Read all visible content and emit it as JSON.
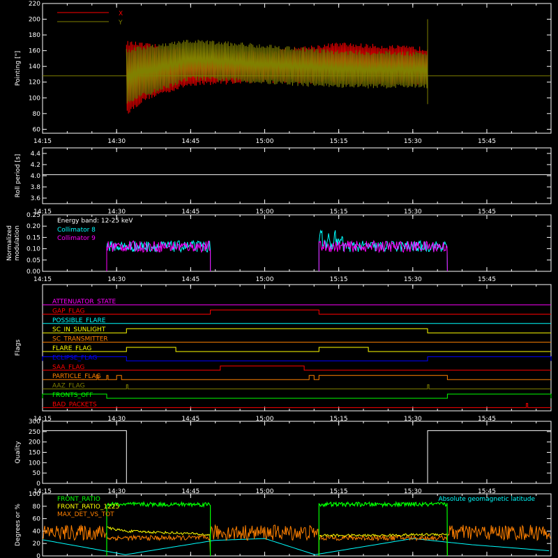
{
  "time_ticks": [
    "14:15",
    "14:30",
    "14:45",
    "15:00",
    "15:15",
    "15:30",
    "15:45"
  ],
  "chart_data": [
    {
      "type": "line",
      "ylabel": "Pointing [\"]",
      "ylim": [
        55,
        220
      ],
      "yticks": [
        60,
        80,
        100,
        120,
        140,
        160,
        180,
        200,
        220
      ],
      "legend": [
        {
          "name": "X",
          "color": "#ff0000"
        },
        {
          "name": "Y",
          "color": "#808000"
        }
      ],
      "series": [
        {
          "name": "X",
          "color": "#ff0000",
          "t_start": "14:32",
          "t_end": "15:33",
          "upper": [
            [
              14.53,
              170
            ],
            [
              14.75,
              160
            ],
            [
              15.0,
              158
            ],
            [
              15.25,
              168
            ],
            [
              15.55,
              162
            ]
          ],
          "lower": [
            [
              14.53,
              80
            ],
            [
              14.6,
              100
            ],
            [
              14.75,
              118
            ],
            [
              15.0,
              122
            ],
            [
              15.25,
              120
            ],
            [
              15.55,
              118
            ]
          ]
        },
        {
          "name": "Y",
          "color": "#808000",
          "t_start": "14:32",
          "t_end": "15:33",
          "upper": [
            [
              14.53,
              160
            ],
            [
              14.75,
              172
            ],
            [
              15.0,
              166
            ],
            [
              15.25,
              158
            ],
            [
              15.55,
              156
            ]
          ],
          "lower": [
            [
              14.53,
              95
            ],
            [
              14.75,
              125
            ],
            [
              15.0,
              120
            ],
            [
              15.25,
              115
            ],
            [
              15.55,
              115
            ]
          ]
        }
      ],
      "reference_y": 128
    },
    {
      "type": "line",
      "ylabel": "Roll period [s]",
      "ylim": [
        3.5,
        4.5
      ],
      "yticks": [
        3.6,
        3.8,
        4.0,
        4.2,
        4.4
      ],
      "series": [
        {
          "name": "",
          "color": "#ffffff",
          "constant": 4.02
        }
      ]
    },
    {
      "type": "line",
      "ylabel": "Normalized modulation",
      "ylim": [
        0,
        0.25
      ],
      "yticks": [
        0.0,
        0.05,
        0.1,
        0.15,
        0.2,
        0.25
      ],
      "annotation": "Energy band: 12-25 keV",
      "legend": [
        {
          "name": "Collimator 8",
          "color": "#00ffff"
        },
        {
          "name": "Collimator 9",
          "color": "#ff00ff"
        }
      ],
      "intervals": [
        [
          "14:28",
          "14:49"
        ],
        [
          "15:11",
          "15:37"
        ]
      ],
      "mean": 0.11
    },
    {
      "type": "line",
      "ylabel": "Flags",
      "flags": [
        {
          "name": "ATTENUATOR_STATE",
          "color": "#ff00ff",
          "high": []
        },
        {
          "name": "GAP_FLAG",
          "color": "#ff0000",
          "high": [
            [
              "14:49",
              "15:11"
            ]
          ]
        },
        {
          "name": "POSSIBLE_FLARE",
          "color": "#00ffff",
          "high": []
        },
        {
          "name": "SC_IN_SUNLIGHT",
          "color": "#ffff00",
          "high": [
            [
              "14:32",
              "15:33"
            ]
          ]
        },
        {
          "name": "SC_TRANSMITTER",
          "color": "#ff8000",
          "high": []
        },
        {
          "name": "FLARE_FLAG",
          "color": "#ffff00",
          "high": [
            [
              "14:32",
              "14:42"
            ],
            [
              "15:11",
              "15:21"
            ]
          ]
        },
        {
          "name": "ECLIPSE_FLAG",
          "color": "#0000ff",
          "high": [
            [
              "14:15",
              "14:32"
            ],
            [
              "15:33",
              "15:58"
            ]
          ]
        },
        {
          "name": "SAA_FLAG",
          "color": "#ff0000",
          "high": [
            [
              "14:51",
              "15:08"
            ]
          ]
        },
        {
          "name": "PARTICLE_FLAG",
          "color": "#ff8000",
          "high": [
            [
              "14:26",
              "14:26"
            ],
            [
              "14:28",
              "14:28"
            ],
            [
              "14:30",
              "14:31"
            ],
            [
              "15:09",
              "15:10"
            ],
            [
              "15:11",
              "15:37"
            ]
          ]
        },
        {
          "name": "AAZ_FLAG",
          "color": "#808000",
          "high": [
            [
              "14:32",
              "14:32"
            ],
            [
              "15:33",
              "15:33"
            ]
          ]
        },
        {
          "name": "FRONTS_OFF",
          "color": "#00ff00",
          "high": [
            [
              "14:15",
              "14:28"
            ],
            [
              "15:37",
              "15:58"
            ]
          ]
        },
        {
          "name": "BAD_PACKETS",
          "color": "#ff0000",
          "high": [
            [
              "15:53",
              "15:53"
            ]
          ]
        }
      ]
    },
    {
      "type": "line",
      "ylabel": "Quality",
      "ylim": [
        0,
        300
      ],
      "yticks": [
        0,
        50,
        100,
        150,
        200,
        250,
        300
      ],
      "series": [
        {
          "name": "",
          "color": "#ffffff",
          "steps": [
            [
              "14:15",
              255
            ],
            [
              "14:32",
              0
            ],
            [
              "15:33",
              255
            ],
            [
              "15:58",
              255
            ]
          ]
        }
      ]
    },
    {
      "type": "line",
      "ylabel": "Degrees or %",
      "ylim": [
        0,
        100
      ],
      "yticks": [
        0,
        20,
        40,
        60,
        80,
        100
      ],
      "legend": [
        {
          "name": "FRONT_RATIO",
          "color": "#00ff00"
        },
        {
          "name": "FRONT_RATIO_1225",
          "color": "#ffff00"
        },
        {
          "name": "MAX_DET_VS_TOT",
          "color": "#ff8000"
        }
      ],
      "legend_right": {
        "name": "Absolute geomagnetic latitude",
        "color": "#00ffff"
      },
      "front_ratio_mean": 83,
      "front_ratio_1225": [
        [
          14.47,
          45
        ],
        [
          14.53,
          40
        ],
        [
          14.75,
          36
        ],
        [
          14.83,
          33
        ],
        [
          15.2,
          33
        ],
        [
          15.4,
          33
        ],
        [
          15.6,
          35
        ]
      ],
      "max_det_mean": 30,
      "latitude": [
        [
          14.25,
          26
        ],
        [
          14.53,
          2
        ],
        [
          14.83,
          25
        ],
        [
          15.0,
          28
        ],
        [
          15.17,
          2
        ],
        [
          15.5,
          28
        ],
        [
          15.7,
          18
        ],
        [
          15.97,
          8
        ]
      ]
    }
  ]
}
